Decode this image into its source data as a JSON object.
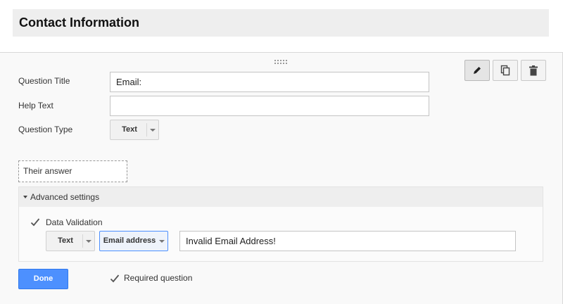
{
  "section": {
    "title": "Contact Information"
  },
  "toolbar": {
    "edit_icon": "pencil-icon",
    "duplicate_icon": "duplicate-icon",
    "delete_icon": "trash-icon"
  },
  "question": {
    "title_label": "Question Title",
    "title_value": "Email:",
    "help_label": "Help Text",
    "help_value": "",
    "type_label": "Question Type",
    "type_value": "Text"
  },
  "preview": {
    "answer_placeholder": "Their answer"
  },
  "advanced": {
    "label": "Advanced settings",
    "validation_label": "Data Validation",
    "validation_checked": true,
    "validation_type": "Text",
    "validation_rule": "Email address",
    "error_message": "Invalid Email Address!"
  },
  "footer": {
    "done_label": "Done",
    "required_label": "Required question",
    "required_checked": true
  },
  "colors": {
    "accent": "#4d90fe",
    "header_bg": "#eeeeee",
    "editor_bg": "#f9f9f9"
  }
}
